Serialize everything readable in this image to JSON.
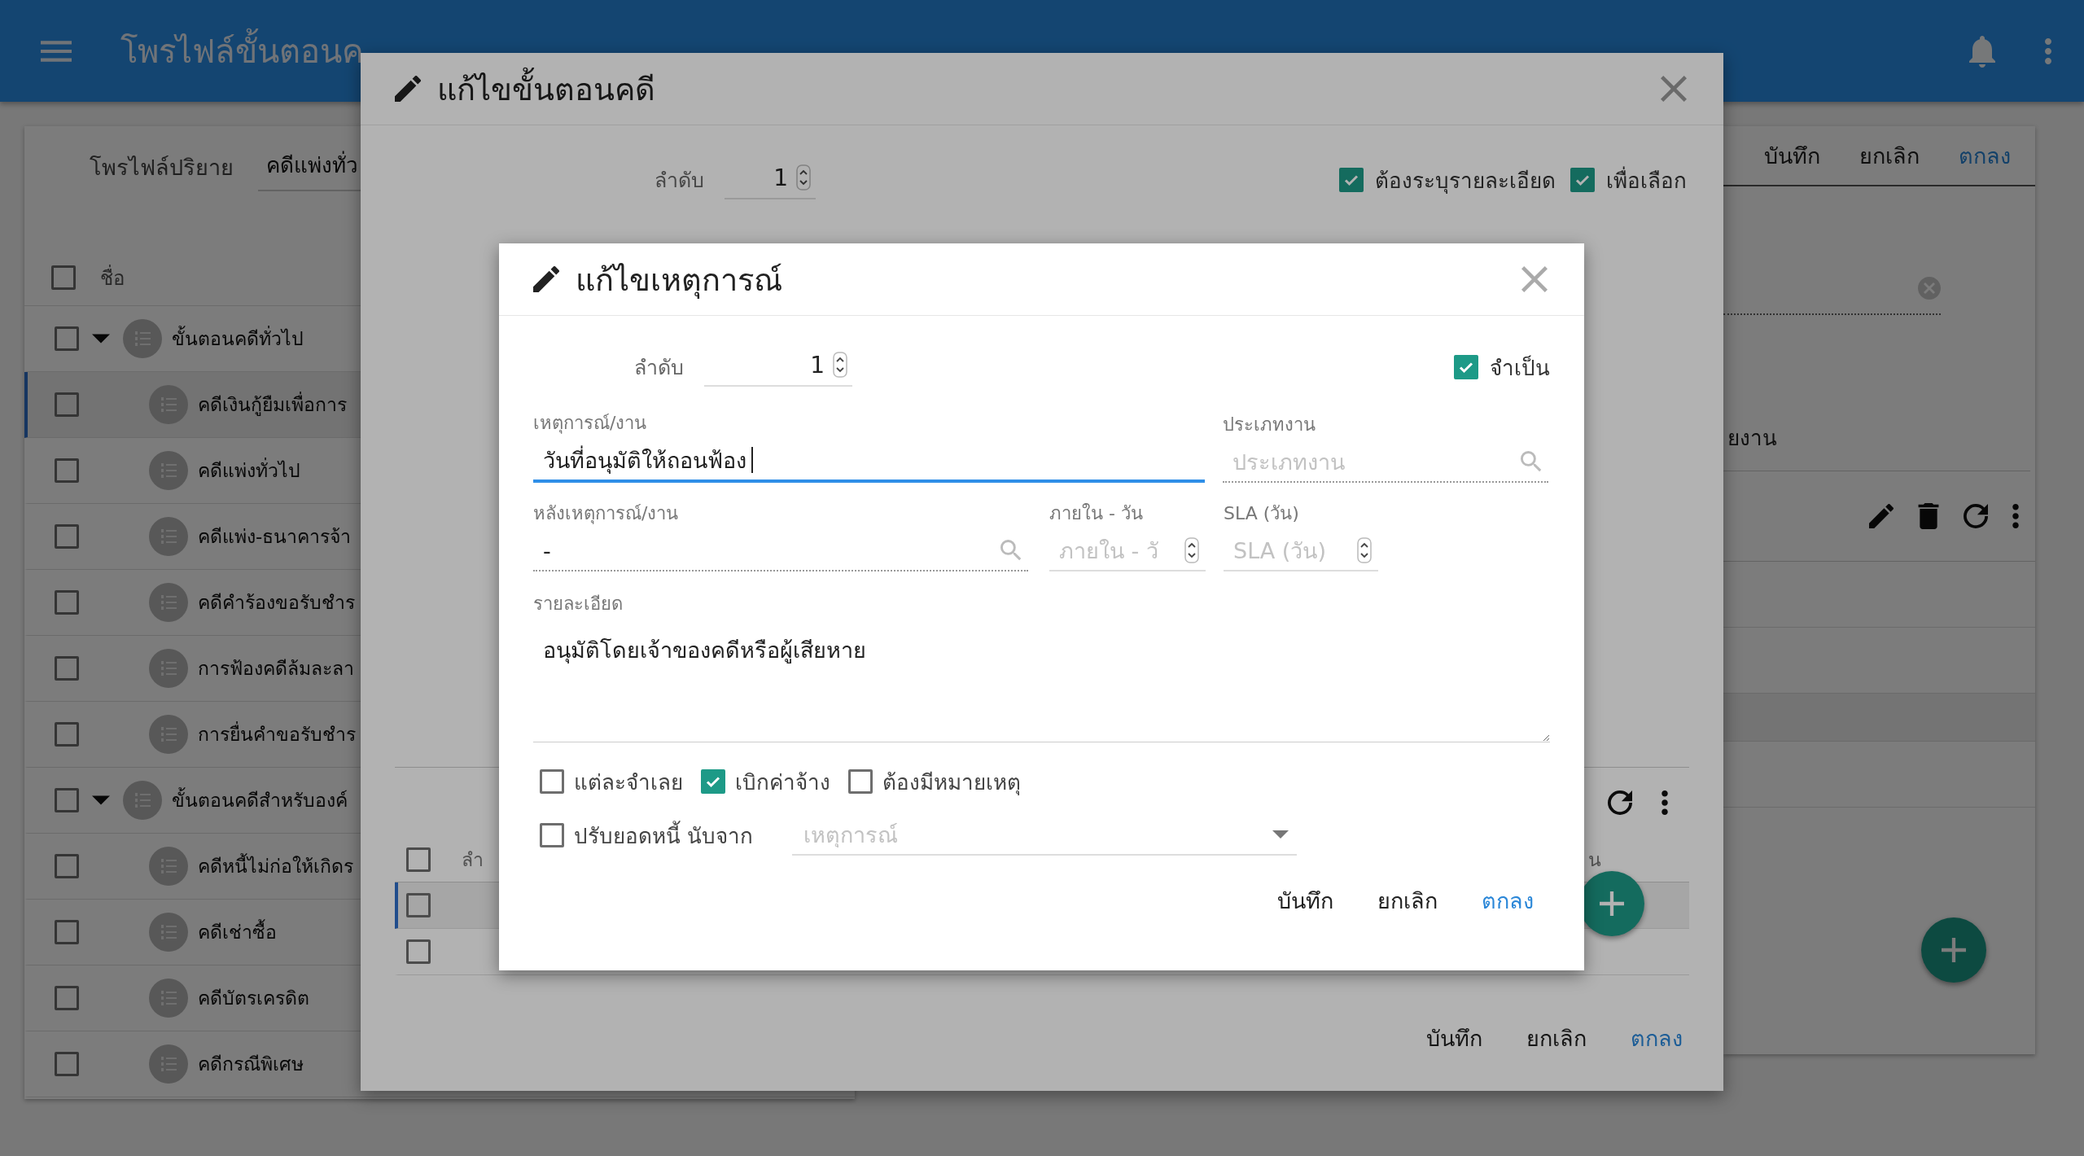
{
  "app_bar": {
    "title": "โพรไฟล์ขั้นตอนค"
  },
  "profile": {
    "label": "โพรไฟล์ปริยาย",
    "value": "คดีแพ่งทั่ว"
  },
  "tree": {
    "header": "ชื่อ",
    "header_checked": false,
    "items": [
      {
        "label": "ขั้นตอนคดีทั่วไป",
        "checked": false,
        "expanded": true,
        "children": [
          {
            "label": "คดีเงินกู้ยืมเพื่อการ",
            "checked": false,
            "selected": true
          },
          {
            "label": "คดีแพ่งทั่วไป",
            "checked": false,
            "selected": false
          },
          {
            "label": "คดีแพ่ง-ธนาคารจ้า",
            "checked": false,
            "selected": false
          },
          {
            "label": "คดีคำร้องขอรับชำร",
            "checked": false,
            "selected": false
          },
          {
            "label": "การฟ้องคดีล้มละลา",
            "checked": false,
            "selected": false
          },
          {
            "label": "การยื่นคำขอรับชำร",
            "checked": false,
            "selected": false
          }
        ]
      },
      {
        "label": "ขั้นตอนคดีสำหรับองค์",
        "checked": false,
        "expanded": true,
        "children": [
          {
            "label": "คดีหนี้ไม่ก่อให้เกิดร",
            "checked": false,
            "selected": false
          },
          {
            "label": "คดีเช่าซื้อ",
            "checked": false,
            "selected": false
          },
          {
            "label": "คดีบัตรเครดิต",
            "checked": false,
            "selected": false
          },
          {
            "label": "คดีกรณีพิเศษ",
            "checked": false,
            "selected": false
          }
        ]
      }
    ]
  },
  "right_panel": {
    "buttons": [
      {
        "label": "บันทึก",
        "kind": "plain"
      },
      {
        "label": "ยกเลิก",
        "kind": "plain"
      },
      {
        "label": "ตกลง",
        "kind": "primary"
      }
    ],
    "field_label": "ยงาน"
  },
  "step_dialog": {
    "title": "แก้ไขขั้นตอนคดี",
    "order_label": "ลำดับ",
    "order_value": "1",
    "options": [
      {
        "label": "ต้องระบุรายละเอียด",
        "checked": true
      },
      {
        "label": "เพื่อเลือก",
        "checked": true
      }
    ],
    "table": {
      "columns": [
        "ลำ",
        "น"
      ],
      "header_checked": false,
      "rows": [
        {
          "checked": false,
          "selected": true
        },
        {
          "checked": false,
          "selected": false
        }
      ]
    },
    "buttons": [
      {
        "label": "บันทึก",
        "kind": "plain"
      },
      {
        "label": "ยกเลิก",
        "kind": "plain"
      },
      {
        "label": "ตกลง",
        "kind": "primary"
      }
    ]
  },
  "event_dialog": {
    "title": "แก้ไขเหตุการณ์",
    "order_label": "ลำดับ",
    "order_value": "1",
    "required": {
      "label": "จำเป็น",
      "checked": true
    },
    "event": {
      "label": "เหตุการณ์/งาน",
      "value": "วันที่อนุมัติให้ถอนฟ้อง",
      "focused": true
    },
    "job_type": {
      "label": "ประเภทงาน",
      "placeholder": "ประเภทงาน"
    },
    "after": {
      "label": "หลังเหตุการณ์/งาน",
      "value": "-"
    },
    "within": {
      "label": "ภายใน - วัน",
      "placeholder": "ภายใน - วั"
    },
    "sla": {
      "label": "SLA (วัน)",
      "placeholder": "SLA (วัน)"
    },
    "details": {
      "label": "รายละเอียด",
      "value": "อนุมัติโดยเจ้าของคดีหรือผู้เสียหาย"
    },
    "flags": [
      {
        "label": "แต่ละจำเลย",
        "checked": false
      },
      {
        "label": "เบิกค่าจ้าง",
        "checked": true
      },
      {
        "label": "ต้องมีหมายเหตุ",
        "checked": false
      }
    ],
    "adjust": {
      "label": "ปรับยอดหนี้ นับจาก",
      "checked": false,
      "placeholder": "เหตุการณ์"
    },
    "buttons": [
      {
        "label": "บันทึก",
        "kind": "plain"
      },
      {
        "label": "ยกเลิก",
        "kind": "plain"
      },
      {
        "label": "ตกลง",
        "kind": "primary"
      }
    ]
  }
}
